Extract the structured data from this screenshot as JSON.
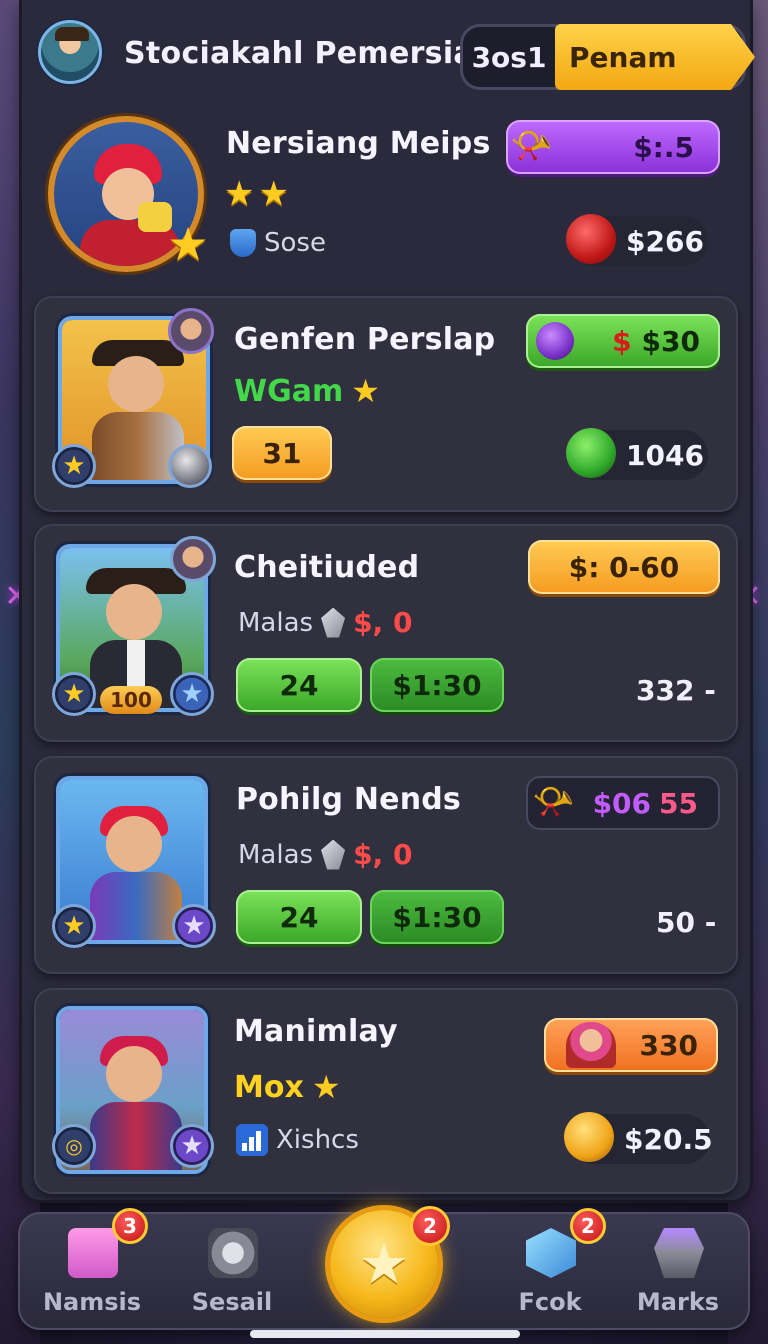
{
  "header": {
    "title": "Stociakahl Pemersia",
    "toggle_left": "3os1",
    "toggle_right": "Penam"
  },
  "rows": [
    {
      "name": "Nersiang Meips",
      "stars": "★★",
      "sub_label": "Sose",
      "pill_label": "$:.5",
      "value": "$266"
    },
    {
      "name": "Genfen Perslap",
      "tag": "WGam",
      "level": "31",
      "pill_red": "$",
      "pill_value": "$30",
      "value": "1046"
    },
    {
      "name": "Cheitiuded",
      "sub_label": "Malas",
      "sub_value": "$, 0",
      "level_badge": "100",
      "btn_left": "24",
      "btn_right": "$1:30",
      "pill_label": "$: 0-60",
      "count": "332 -"
    },
    {
      "name": "Pohilg Nends",
      "sub_label": "Malas",
      "sub_value": "$, 0",
      "btn_left": "24",
      "btn_right": "$1:30",
      "pill_purple": "$06",
      "pill_pink": "55",
      "count": "50 -"
    },
    {
      "name": "Manimlay",
      "tag": "Mox",
      "sub_label": "Xishcs",
      "pill_value": "330",
      "value": "$20.5"
    }
  ],
  "nav": {
    "items": [
      {
        "label": "Namsis",
        "badge": "3"
      },
      {
        "label": "Sesail",
        "badge": ""
      },
      {
        "label": "",
        "badge": "2"
      },
      {
        "label": "Fcok",
        "badge": "2"
      },
      {
        "label": "Marks",
        "badge": ""
      }
    ]
  },
  "colors": {
    "accent_gold": "#f6b81a",
    "accent_purple": "#8a2fd8",
    "accent_green": "#3aa628",
    "panel": "#2b2a3c"
  }
}
